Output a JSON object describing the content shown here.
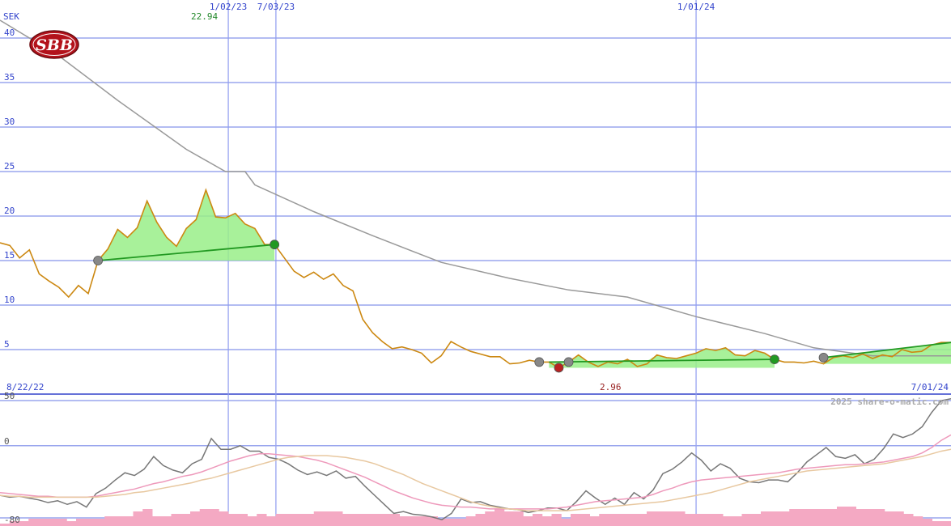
{
  "chart_data": [
    {
      "type": "line",
      "title": "",
      "logo_text": "SBB",
      "ylabel": "SEK",
      "ylim": [
        0,
        42
      ],
      "yticks": [
        5,
        10,
        15,
        20,
        25,
        30,
        35,
        40
      ],
      "x_tick_labels": [
        {
          "date": "2023-02-01",
          "label": "1/02/23"
        },
        {
          "date": "2023-03-07",
          "label": "7/03/23"
        },
        {
          "date": "2024-01-01",
          "label": "1/01/24"
        }
      ],
      "x_range_labels": {
        "start": "8/22/22",
        "end": "7/01/24"
      },
      "x_range": [
        "2022-08-22",
        "2024-07-01"
      ],
      "max_annotation": {
        "date": "2023-02-13",
        "value": 22.94,
        "label": "22.94"
      },
      "min_annotation": {
        "date": "2023-10-02",
        "value": 2.96,
        "label": "2.96"
      },
      "series": [
        {
          "name": "",
          "color": "#cc8811",
          "points": [
            [
              "2022-08-22",
              17.0
            ],
            [
              "2022-08-29",
              16.7
            ],
            [
              "2022-09-05",
              15.3
            ],
            [
              "2022-09-12",
              16.2
            ],
            [
              "2022-09-19",
              13.5
            ],
            [
              "2022-09-26",
              12.7
            ],
            [
              "2022-10-03",
              12.0
            ],
            [
              "2022-10-10",
              10.9
            ],
            [
              "2022-10-17",
              12.2
            ],
            [
              "2022-10-24",
              11.3
            ],
            [
              "2022-10-31",
              15.0
            ],
            [
              "2022-11-07",
              16.3
            ],
            [
              "2022-11-14",
              18.5
            ],
            [
              "2022-11-21",
              17.6
            ],
            [
              "2022-11-28",
              18.7
            ],
            [
              "2022-12-05",
              21.7
            ],
            [
              "2022-12-12",
              19.3
            ],
            [
              "2022-12-19",
              17.6
            ],
            [
              "2022-12-26",
              16.6
            ],
            [
              "2023-01-02",
              18.6
            ],
            [
              "2023-01-09",
              19.6
            ],
            [
              "2023-01-16",
              22.94
            ],
            [
              "2023-01-23",
              19.9
            ],
            [
              "2023-01-30",
              19.8
            ],
            [
              "2023-02-06",
              20.3
            ],
            [
              "2023-02-13",
              19.1
            ],
            [
              "2023-02-20",
              18.6
            ],
            [
              "2023-02-27",
              16.8
            ],
            [
              "2023-03-06",
              16.8
            ],
            [
              "2023-03-13",
              15.3
            ],
            [
              "2023-03-20",
              13.8
            ],
            [
              "2023-03-27",
              13.1
            ],
            [
              "2023-04-03",
              13.7
            ],
            [
              "2023-04-10",
              12.9
            ],
            [
              "2023-04-17",
              13.5
            ],
            [
              "2023-04-24",
              12.2
            ],
            [
              "2023-05-01",
              11.6
            ],
            [
              "2023-05-08",
              8.4
            ],
            [
              "2023-05-15",
              6.9
            ],
            [
              "2023-05-22",
              5.9
            ],
            [
              "2023-05-29",
              5.1
            ],
            [
              "2023-06-05",
              5.3
            ],
            [
              "2023-06-12",
              5.0
            ],
            [
              "2023-06-19",
              4.6
            ],
            [
              "2023-06-26",
              3.5
            ],
            [
              "2023-07-03",
              4.3
            ],
            [
              "2023-07-10",
              5.9
            ],
            [
              "2023-07-17",
              5.3
            ],
            [
              "2023-07-24",
              4.8
            ],
            [
              "2023-07-31",
              4.5
            ],
            [
              "2023-08-07",
              4.2
            ],
            [
              "2023-08-14",
              4.2
            ],
            [
              "2023-08-21",
              3.4
            ],
            [
              "2023-08-28",
              3.5
            ],
            [
              "2023-09-04",
              3.8
            ],
            [
              "2023-09-11",
              3.6
            ],
            [
              "2023-09-18",
              3.6
            ],
            [
              "2023-09-25",
              2.96
            ],
            [
              "2023-10-02",
              3.6
            ],
            [
              "2023-10-09",
              4.4
            ],
            [
              "2023-10-16",
              3.6
            ],
            [
              "2023-10-23",
              3.1
            ],
            [
              "2023-10-30",
              3.6
            ],
            [
              "2023-11-06",
              3.4
            ],
            [
              "2023-11-13",
              3.9
            ],
            [
              "2023-11-20",
              3.1
            ],
            [
              "2023-11-27",
              3.4
            ],
            [
              "2023-12-04",
              4.4
            ],
            [
              "2023-12-11",
              4.1
            ],
            [
              "2023-12-18",
              4.0
            ],
            [
              "2023-12-25",
              4.3
            ],
            [
              "2024-01-01",
              4.6
            ],
            [
              "2024-01-08",
              5.1
            ],
            [
              "2024-01-15",
              4.9
            ],
            [
              "2024-01-22",
              5.2
            ],
            [
              "2024-01-29",
              4.4
            ],
            [
              "2024-02-05",
              4.3
            ],
            [
              "2024-02-12",
              4.9
            ],
            [
              "2024-02-19",
              4.6
            ],
            [
              "2024-02-26",
              3.9
            ],
            [
              "2024-03-04",
              3.6
            ],
            [
              "2024-03-11",
              3.6
            ],
            [
              "2024-03-18",
              3.5
            ],
            [
              "2024-03-25",
              3.7
            ],
            [
              "2024-04-01",
              3.4
            ],
            [
              "2024-04-08",
              4.1
            ],
            [
              "2024-04-15",
              4.3
            ],
            [
              "2024-04-22",
              4.1
            ],
            [
              "2024-04-29",
              4.5
            ],
            [
              "2024-05-06",
              4.0
            ],
            [
              "2024-05-13",
              4.4
            ],
            [
              "2024-05-20",
              4.2
            ],
            [
              "2024-05-27",
              5.0
            ],
            [
              "2024-06-03",
              4.7
            ],
            [
              "2024-06-10",
              4.8
            ],
            [
              "2024-06-17",
              5.5
            ],
            [
              "2024-06-24",
              5.8
            ],
            [
              "2024-07-01",
              5.8
            ]
          ]
        },
        {
          "name": "",
          "color": "#999999",
          "points": [
            [
              "2022-08-22",
              42.0
            ],
            [
              "2022-10-03",
              38.0
            ],
            [
              "2022-11-14",
              33.0
            ],
            [
              "2023-01-02",
              27.5
            ],
            [
              "2023-01-30",
              25.0
            ],
            [
              "2023-02-13",
              25.0
            ],
            [
              "2023-02-20",
              23.5
            ],
            [
              "2023-04-03",
              20.5
            ],
            [
              "2023-05-15",
              17.8
            ],
            [
              "2023-07-03",
              14.8
            ],
            [
              "2023-08-21",
              13.0
            ],
            [
              "2023-10-02",
              11.7
            ],
            [
              "2023-11-13",
              10.9
            ],
            [
              "2024-01-01",
              8.7
            ],
            [
              "2024-02-19",
              6.8
            ],
            [
              "2024-03-25",
              5.2
            ],
            [
              "2024-05-06",
              4.3
            ],
            [
              "2024-07-01",
              4.3
            ]
          ]
        }
      ],
      "trend_segments": [
        {
          "start": [
            "2022-10-31",
            15.0
          ],
          "end": [
            "2023-03-06",
            16.8
          ]
        },
        {
          "start": [
            "2023-09-18",
            3.6
          ],
          "end": [
            "2024-02-26",
            3.9
          ]
        },
        {
          "start": [
            "2024-04-01",
            4.1
          ],
          "end": [
            "2024-07-01",
            5.8
          ]
        }
      ],
      "markers": [
        {
          "date": "2022-10-31",
          "value": 15.0,
          "color": "#888888"
        },
        {
          "date": "2023-03-06",
          "value": 16.8,
          "color": "#229922"
        },
        {
          "date": "2023-09-11",
          "value": 3.6,
          "color": "#888888"
        },
        {
          "date": "2023-09-25",
          "value": 2.96,
          "color": "#bb2222"
        },
        {
          "date": "2023-10-02",
          "value": 3.6,
          "color": "#888888"
        },
        {
          "date": "2024-02-26",
          "value": 3.9,
          "color": "#229922"
        },
        {
          "date": "2024-04-01",
          "value": 4.1,
          "color": "#888888"
        }
      ]
    },
    {
      "type": "line",
      "title": "",
      "watermark": "2025 share-o-matic.com",
      "ylim": [
        -80,
        50
      ],
      "yticks": [
        {
          "value": 50,
          "label": "50"
        },
        {
          "value": 0,
          "label": "0"
        },
        {
          "value": -80,
          "label": "-80"
        }
      ],
      "series": [
        {
          "name": "",
          "color": "#777777",
          "values": [
            -55,
            -57,
            -56,
            -58,
            -60,
            -63,
            -61,
            -65,
            -62,
            -68,
            -53,
            -47,
            -38,
            -30,
            -33,
            -26,
            -12,
            -22,
            -27,
            -30,
            -20,
            -15,
            8,
            -4,
            -4,
            0,
            -6,
            -6,
            -13,
            -15,
            -20,
            -27,
            -32,
            -29,
            -33,
            -28,
            -36,
            -34,
            -45,
            -55,
            -65,
            -75,
            -73,
            -76,
            -77,
            -79,
            -82,
            -75,
            -59,
            -63,
            -62,
            -66,
            -68,
            -70,
            -71,
            -74,
            -72,
            -69,
            -69,
            -72,
            -62,
            -50,
            -58,
            -65,
            -58,
            -65,
            -52,
            -59,
            -49,
            -31,
            -26,
            -18,
            -8,
            -16,
            -28,
            -20,
            -25,
            -36,
            -40,
            -41,
            -38,
            -38,
            -40,
            -30,
            -18,
            -10,
            -2,
            -12,
            -14,
            -10,
            -20,
            -15,
            -3,
            13,
            9,
            13,
            21,
            37,
            50,
            52
          ]
        },
        {
          "name": "",
          "color": "#ee99bb",
          "values": [
            -52,
            -53,
            -54,
            -55,
            -56,
            -56,
            -57,
            -57,
            -57,
            -57,
            -56,
            -54,
            -52,
            -50,
            -48,
            -45,
            -42,
            -40,
            -37,
            -34,
            -32,
            -29,
            -25,
            -21,
            -17,
            -14,
            -11,
            -9,
            -9,
            -10,
            -11,
            -12,
            -14,
            -16,
            -19,
            -23,
            -27,
            -31,
            -35,
            -40,
            -45,
            -50,
            -54,
            -58,
            -61,
            -64,
            -66,
            -67,
            -68,
            -68,
            -69,
            -70,
            -70,
            -70,
            -70,
            -70,
            -70,
            -70,
            -69,
            -68,
            -66,
            -64,
            -62,
            -61,
            -60,
            -59,
            -58,
            -57,
            -54,
            -50,
            -47,
            -43,
            -40,
            -38,
            -37,
            -36,
            -35,
            -34,
            -33,
            -32,
            -31,
            -30,
            -28,
            -26,
            -25,
            -24,
            -23,
            -22,
            -21,
            -21,
            -20,
            -19,
            -18,
            -16,
            -14,
            -12,
            -8,
            -2,
            6,
            12
          ]
        },
        {
          "name": "",
          "color": "#e8c8a0",
          "values": [
            -55,
            -56,
            -56,
            -57,
            -57,
            -57,
            -57,
            -57,
            -57,
            -57,
            -57,
            -56,
            -55,
            -54,
            -52,
            -51,
            -49,
            -47,
            -45,
            -43,
            -41,
            -38,
            -36,
            -33,
            -30,
            -27,
            -24,
            -21,
            -18,
            -15,
            -13,
            -12,
            -11,
            -11,
            -11,
            -12,
            -13,
            -15,
            -17,
            -20,
            -24,
            -28,
            -32,
            -37,
            -42,
            -46,
            -50,
            -54,
            -58,
            -62,
            -65,
            -67,
            -69,
            -70,
            -71,
            -72,
            -72,
            -72,
            -72,
            -72,
            -71,
            -70,
            -69,
            -68,
            -67,
            -66,
            -65,
            -64,
            -63,
            -62,
            -60,
            -58,
            -56,
            -54,
            -52,
            -49,
            -46,
            -43,
            -40,
            -38,
            -36,
            -34,
            -32,
            -30,
            -28,
            -27,
            -26,
            -25,
            -24,
            -23,
            -22,
            -21,
            -20,
            -18,
            -16,
            -14,
            -12,
            -9,
            -6,
            -4
          ]
        }
      ],
      "volume_bars": [
        1,
        2,
        2,
        3,
        3,
        3,
        3,
        2,
        3,
        3,
        3,
        4,
        4,
        4,
        6,
        7,
        4,
        4,
        5,
        5,
        6,
        7,
        7,
        6,
        5,
        5,
        4,
        5,
        4,
        5,
        5,
        5,
        5,
        6,
        6,
        6,
        5,
        5,
        5,
        5,
        5,
        5,
        4,
        4,
        4,
        4,
        3,
        3,
        3,
        4,
        5,
        6,
        7,
        6,
        6,
        4,
        5,
        4,
        5,
        3,
        5,
        5,
        4,
        5,
        5,
        5,
        5,
        5,
        6,
        6,
        6,
        6,
        5,
        5,
        5,
        5,
        4,
        4,
        5,
        5,
        6,
        6,
        6,
        7,
        7,
        7,
        7,
        7,
        8,
        8,
        7,
        7,
        7,
        6,
        6,
        5,
        4,
        3,
        2,
        2
      ]
    }
  ]
}
